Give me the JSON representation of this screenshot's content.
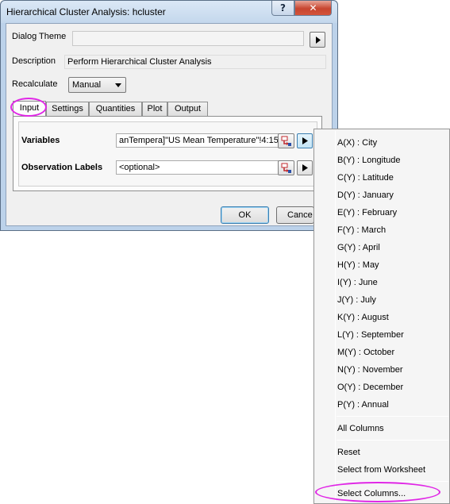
{
  "window": {
    "title": "Hierarchical Cluster Analysis: hcluster",
    "help_glyph": "?",
    "close_glyph": "✕"
  },
  "dialog": {
    "theme_label": "Dialog Theme",
    "theme_value": "",
    "description_label": "Description",
    "description_value": "Perform Hierarchical Cluster Analysis",
    "recalculate_label": "Recalculate",
    "recalculate_value": "Manual"
  },
  "tabs": [
    {
      "label": "Input"
    },
    {
      "label": "Settings"
    },
    {
      "label": "Quantities"
    },
    {
      "label": "Plot"
    },
    {
      "label": "Output"
    }
  ],
  "input": {
    "variables_label": "Variables",
    "variables_value": "anTempera]\"US Mean Temperature\"!4:15",
    "obs_label": "Observation Labels",
    "obs_placeholder": "<optional>"
  },
  "buttons": {
    "ok": "OK",
    "cancel": "Cance"
  },
  "menu": {
    "columns": [
      "A(X) : City",
      "B(Y) : Longitude",
      "C(Y) : Latitude",
      "D(Y) : January",
      "E(Y) : February",
      "F(Y) : March",
      "G(Y) : April",
      "H(Y) : May",
      "I(Y) : June",
      "J(Y) : July",
      "K(Y) : August",
      "L(Y) : September",
      "M(Y) : October",
      "N(Y) : November",
      "O(Y) : December",
      "P(Y) : Annual"
    ],
    "all_columns": "All Columns",
    "reset": "Reset",
    "select_from_worksheet": "Select from Worksheet",
    "select_columns": "Select Columns..."
  },
  "colors": {
    "highlight": "#e026e6",
    "close_button": "#c7452f",
    "window_frame": "#bcd2ea"
  }
}
